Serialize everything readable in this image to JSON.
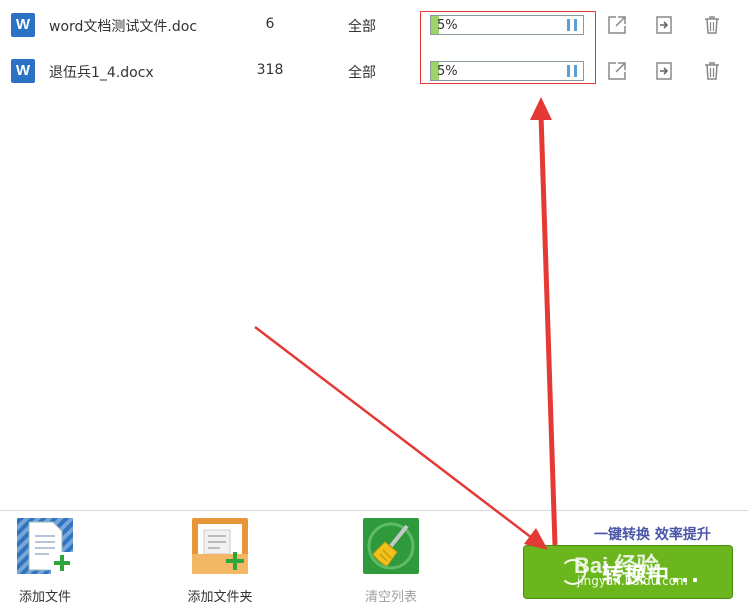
{
  "files": [
    {
      "icon": "word-icon",
      "icon_letter": "W",
      "name": "word文档测试文件.doc",
      "pages": "6",
      "range": "全部",
      "progress_label": "5%",
      "progress": 5
    },
    {
      "icon": "word-icon",
      "icon_letter": "W",
      "name": "退伍兵1_4.docx",
      "pages": "318",
      "range": "全部",
      "progress_label": "5%",
      "progress": 5
    }
  ],
  "toolbar": {
    "add_file_label": "添加文件",
    "add_folder_label": "添加文件夹",
    "clear_list_label": "清空列表"
  },
  "slogan": "一键转换  效率提升",
  "convert_button_label": "转换中...",
  "watermark": {
    "brand": "Bai 经验",
    "url": "jingyan.baidu.com"
  },
  "colors": {
    "accent_green": "#6cb61d",
    "annotation_red": "#e53935",
    "word_blue": "#2a72c4"
  }
}
